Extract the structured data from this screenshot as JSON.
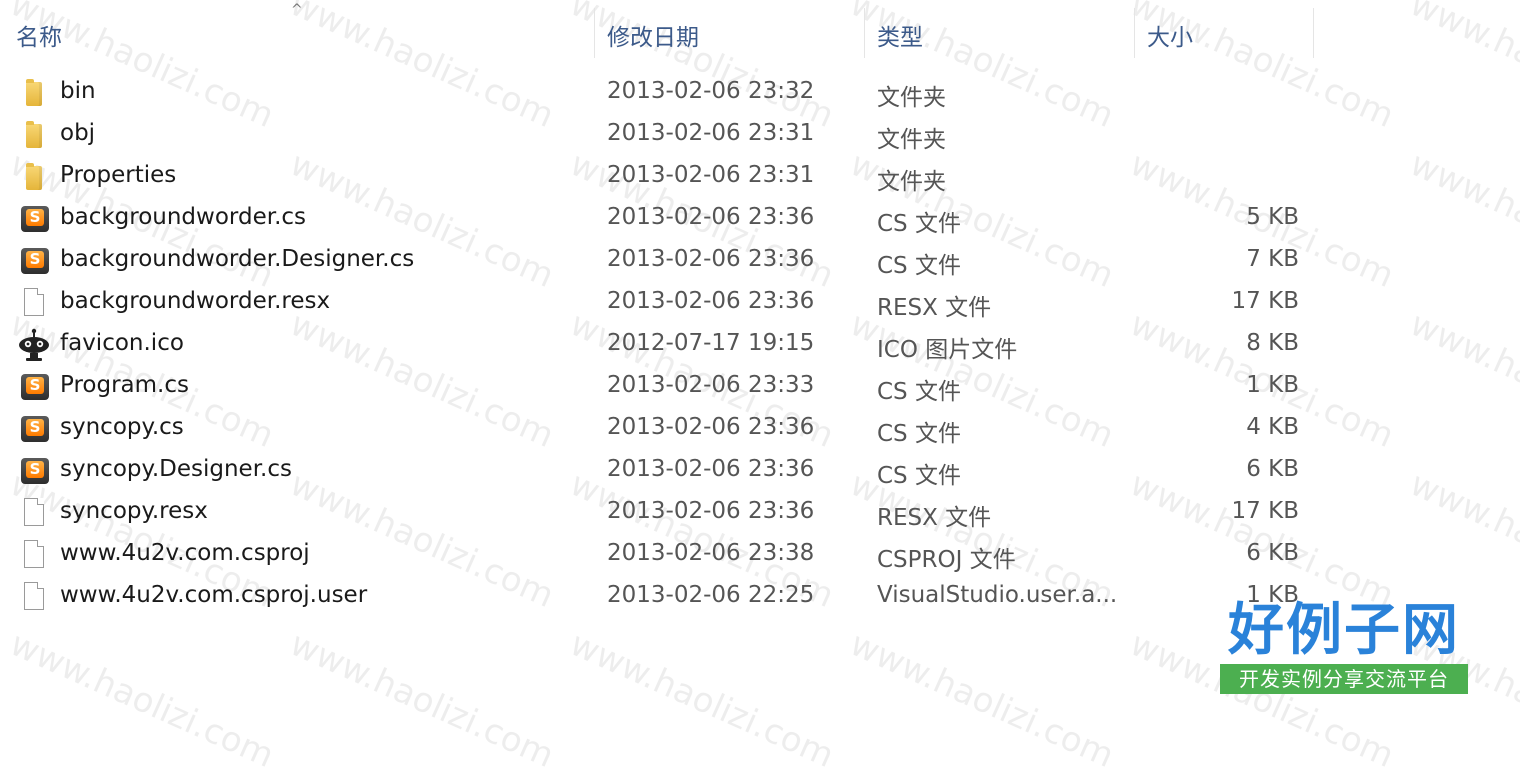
{
  "header": {
    "col_name": "名称",
    "col_date": "修改日期",
    "col_type": "类型",
    "col_size": "大小",
    "sort_indicator": "^"
  },
  "files": [
    {
      "name": "bin",
      "date": "2013-02-06 23:32",
      "type": "文件夹",
      "size": "",
      "icon": "folder-icon"
    },
    {
      "name": "obj",
      "date": "2013-02-06 23:31",
      "type": "文件夹",
      "size": "",
      "icon": "folder-icon"
    },
    {
      "name": "Properties",
      "date": "2013-02-06 23:31",
      "type": "文件夹",
      "size": "",
      "icon": "folder-icon"
    },
    {
      "name": "backgroundworder.cs",
      "date": "2013-02-06 23:36",
      "type": "CS 文件",
      "size": "5 KB",
      "icon": "cs-file-icon"
    },
    {
      "name": "backgroundworder.Designer.cs",
      "date": "2013-02-06 23:36",
      "type": "CS 文件",
      "size": "7 KB",
      "icon": "cs-file-icon"
    },
    {
      "name": "backgroundworder.resx",
      "date": "2013-02-06 23:36",
      "type": "RESX 文件",
      "size": "17 KB",
      "icon": "blank-file-icon"
    },
    {
      "name": "favicon.ico",
      "date": "2012-07-17 19:15",
      "type": "ICO 图片文件",
      "size": "8 KB",
      "icon": "robot-image-icon"
    },
    {
      "name": "Program.cs",
      "date": "2013-02-06 23:33",
      "type": "CS 文件",
      "size": "1 KB",
      "icon": "cs-file-icon"
    },
    {
      "name": "syncopy.cs",
      "date": "2013-02-06 23:36",
      "type": "CS 文件",
      "size": "4 KB",
      "icon": "cs-file-icon"
    },
    {
      "name": "syncopy.Designer.cs",
      "date": "2013-02-06 23:36",
      "type": "CS 文件",
      "size": "6 KB",
      "icon": "cs-file-icon"
    },
    {
      "name": "syncopy.resx",
      "date": "2013-02-06 23:36",
      "type": "RESX 文件",
      "size": "17 KB",
      "icon": "blank-file-icon"
    },
    {
      "name": "www.4u2v.com.csproj",
      "date": "2013-02-06 23:38",
      "type": "CSPROJ 文件",
      "size": "6 KB",
      "icon": "blank-file-icon"
    },
    {
      "name": "www.4u2v.com.csproj.user",
      "date": "2013-02-06 22:25",
      "type": "VisualStudio.user.a...",
      "size": "1 KB",
      "icon": "blank-file-icon"
    }
  ],
  "watermark": "www.haolizi.com",
  "logo": {
    "title": "好例子网",
    "subtitle": "开发实例分享交流平台"
  },
  "colors": {
    "header_text": "#3c5a8a",
    "logo_blue": "#2a82d9",
    "logo_green": "#4caf50"
  }
}
